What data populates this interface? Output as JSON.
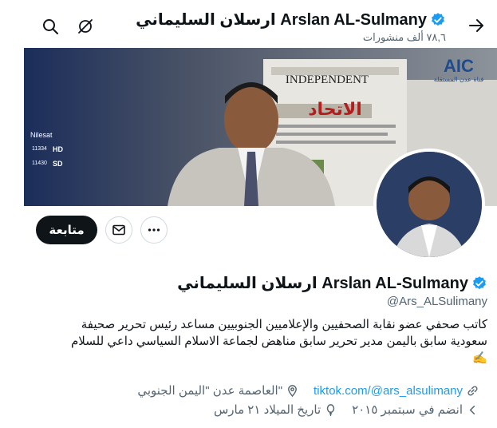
{
  "header": {
    "display_name": "Arslan AL-Sulmany ارسلان السليماني",
    "posts_count": "٧٨,٦ ألف منشورات"
  },
  "banner": {
    "channel_logo": "AIC",
    "channel_subtitle": "قناة عدن المستقلة",
    "newspaper_masthead": "INDEPENDENT",
    "newspaper_arabic": "الاتحاد",
    "ticker": [
      "Nilesat",
      "11334",
      "HD",
      "11430",
      "SD"
    ]
  },
  "actions": {
    "follow_label": "متابعة"
  },
  "profile": {
    "display_name": "Arslan AL-Sulmany ارسلان السليماني",
    "handle": "@Ars_ALSulimany",
    "bio_line1": "كاتب صحفي عضو نقابة الصحفيين والإعلاميين الجنوبيين مساعد رئيس تحرير صحيفة",
    "bio_line2": "سعودية سابق باليمن مدير تحرير سابق مناهض لجماعة الاسلام السياسي داعي للسلام",
    "bio_emoji": "✍️",
    "location": "\"العاصمة عدن \"اليمن الجنوبي",
    "website": "tiktok.com/@ars_alsulimany",
    "birthday": "تاريخ الميلاد ٢١ مارس",
    "joined": "انضم في سبتمبر ٢٠١٥"
  },
  "colors": {
    "accent": "#1d9bf0",
    "text": "#0f1419",
    "secondary": "#536471"
  }
}
